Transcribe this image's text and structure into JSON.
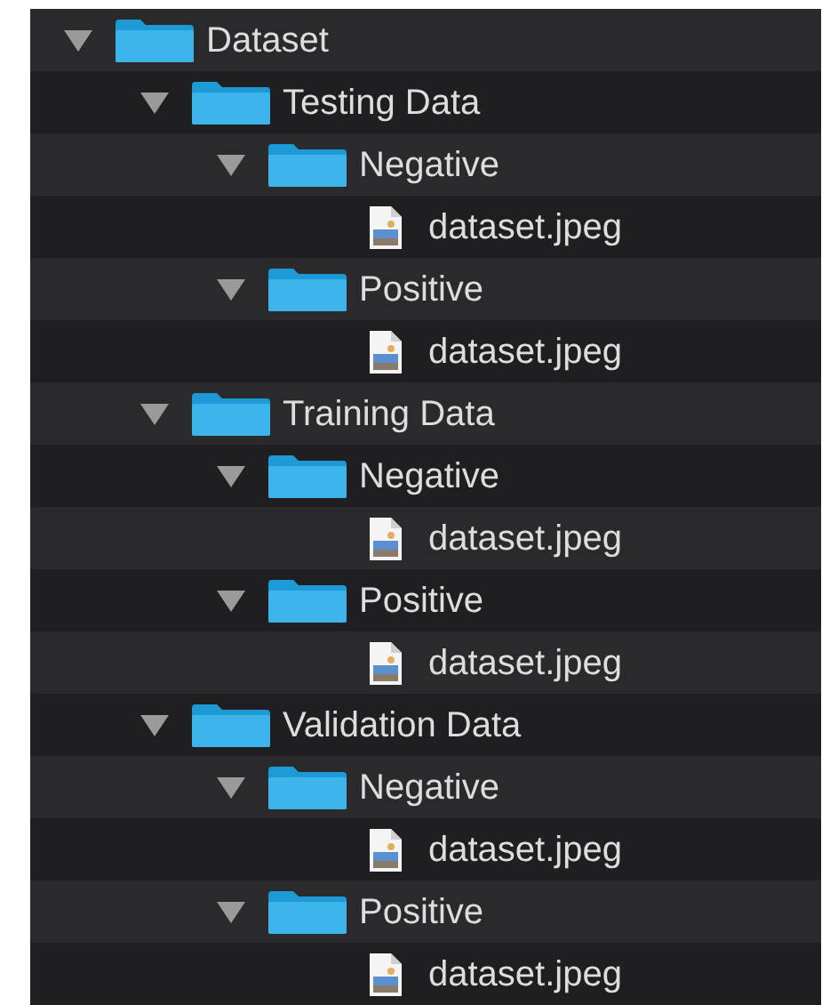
{
  "tree": [
    {
      "kind": "folder",
      "label": "Dataset",
      "expanded": true,
      "children": [
        {
          "kind": "folder",
          "label": "Testing Data",
          "expanded": true,
          "children": [
            {
              "kind": "folder",
              "label": "Negative",
              "expanded": true,
              "children": [
                {
                  "kind": "file",
                  "label": "dataset.jpeg"
                }
              ]
            },
            {
              "kind": "folder",
              "label": "Positive",
              "expanded": true,
              "children": [
                {
                  "kind": "file",
                  "label": "dataset.jpeg"
                }
              ]
            }
          ]
        },
        {
          "kind": "folder",
          "label": "Training Data",
          "expanded": true,
          "children": [
            {
              "kind": "folder",
              "label": "Negative",
              "expanded": true,
              "children": [
                {
                  "kind": "file",
                  "label": "dataset.jpeg"
                }
              ]
            },
            {
              "kind": "folder",
              "label": "Positive",
              "expanded": true,
              "children": [
                {
                  "kind": "file",
                  "label": "dataset.jpeg"
                }
              ]
            }
          ]
        },
        {
          "kind": "folder",
          "label": "Validation Data",
          "expanded": true,
          "children": [
            {
              "kind": "folder",
              "label": "Negative",
              "expanded": true,
              "children": [
                {
                  "kind": "file",
                  "label": "dataset.jpeg"
                }
              ]
            },
            {
              "kind": "folder",
              "label": "Positive",
              "expanded": true,
              "children": [
                {
                  "kind": "file",
                  "label": "dataset.jpeg"
                }
              ]
            }
          ]
        }
      ]
    }
  ]
}
